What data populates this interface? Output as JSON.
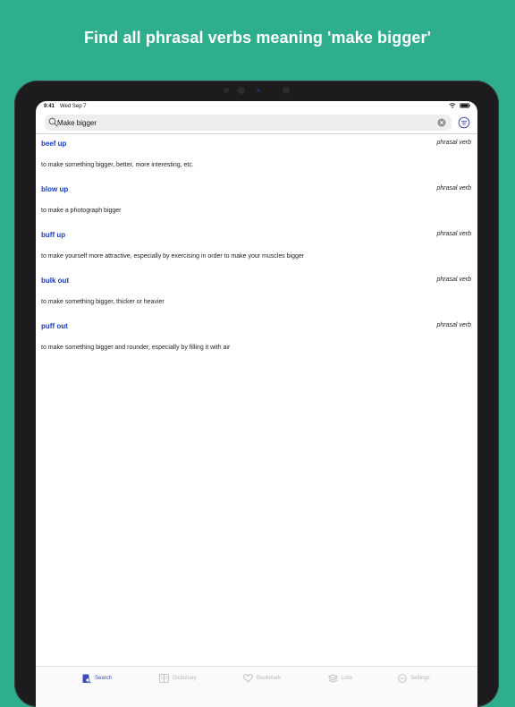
{
  "headline": "Find all phrasal verbs meaning 'make bigger'",
  "status": {
    "time": "9:41",
    "date": "Wed Sep 7",
    "icons": [
      "wifi-icon",
      "battery-icon"
    ]
  },
  "search": {
    "value": "Make bigger",
    "placeholder": "",
    "icons": [
      "search-icon",
      "clear-icon",
      "filter-icon"
    ]
  },
  "results": [
    {
      "word": "beef up",
      "pos": "phrasal verb",
      "definition": "to make something bigger, better, more interesting, etc."
    },
    {
      "word": "blow up",
      "pos": "phrasal verb",
      "definition": "to make a photograph bigger"
    },
    {
      "word": "buff up",
      "pos": "phrasal verb",
      "definition": "to make yourself more attractive, especially by exercising in order to make your muscles bigger"
    },
    {
      "word": "bulk out",
      "pos": "phrasal verb",
      "definition": "to make something bigger, thicker or heavier"
    },
    {
      "word": "puff out",
      "pos": "phrasal verb",
      "definition": "to make something bigger and rounder, especially by filling it with air"
    }
  ],
  "tabs": [
    {
      "label": "Search",
      "icon": "search-tab-icon",
      "active": true
    },
    {
      "label": "Dictionary",
      "icon": "dictionary-icon",
      "active": false
    },
    {
      "label": "Bookmark",
      "icon": "heart-icon",
      "active": false
    },
    {
      "label": "Lists",
      "icon": "layers-icon",
      "active": false
    },
    {
      "label": "Settings",
      "icon": "more-icon",
      "active": false
    }
  ],
  "colors": {
    "background": "#2eae8c",
    "accent": "#3e4ab8",
    "entry_word": "#1a3bc4",
    "inactive_tab": "#b6b6b8"
  }
}
